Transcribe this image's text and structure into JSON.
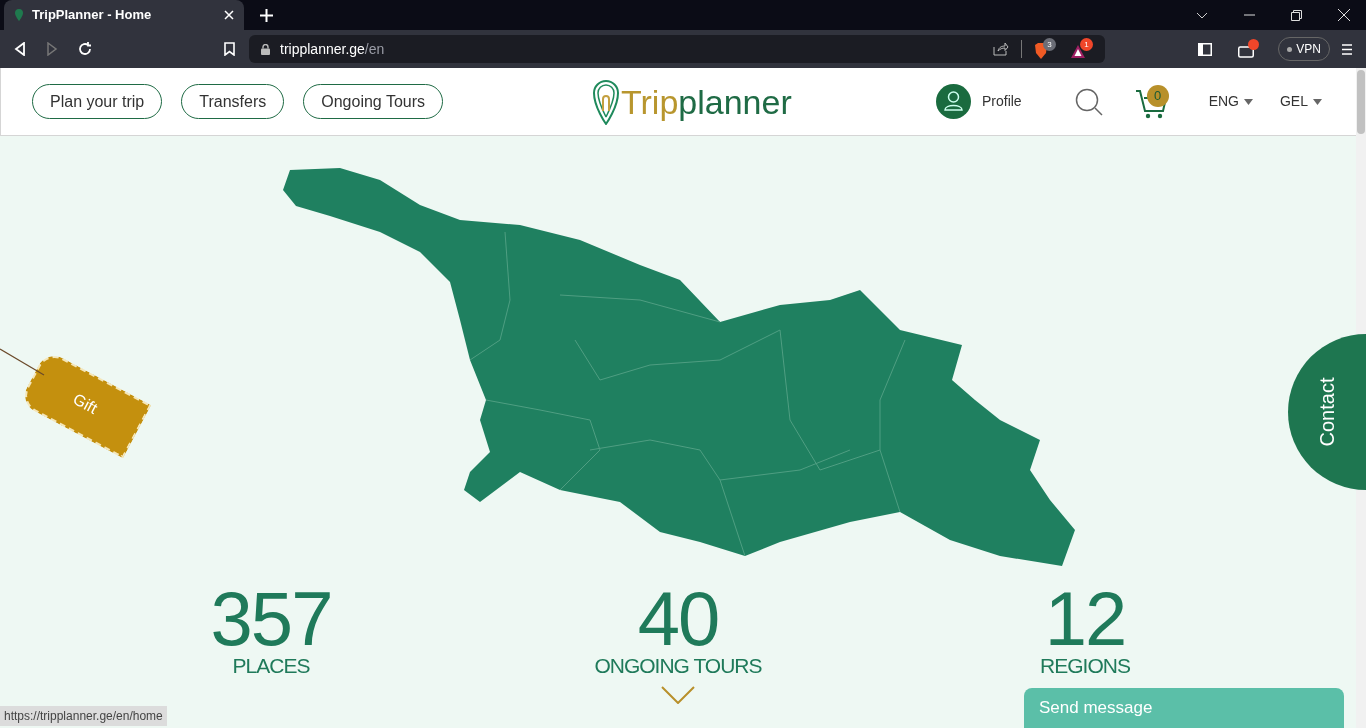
{
  "browser": {
    "tab_title": "TripPlanner - Home",
    "url_host": "tripplanner.ge",
    "url_path": "/en",
    "shield_badge": "3",
    "rewards_badge": "1",
    "vpn": "VPN"
  },
  "header": {
    "nav": [
      "Plan your trip",
      "Transfers",
      "Ongoing Tours"
    ],
    "logo": {
      "part_1": "Trip",
      "part_2": "planner"
    },
    "profile": "Profile",
    "cart_count": "0",
    "language": "ENG",
    "currency": "GEL"
  },
  "gift": "Gift",
  "contact": "Contact",
  "stats": [
    {
      "value": "357",
      "label": "PLACES"
    },
    {
      "value": "40",
      "label": "ONGOING TOURS"
    },
    {
      "value": "12",
      "label": "REGIONS"
    }
  ],
  "send_message": "Send message",
  "status_url": "https://tripplanner.ge/en/home"
}
